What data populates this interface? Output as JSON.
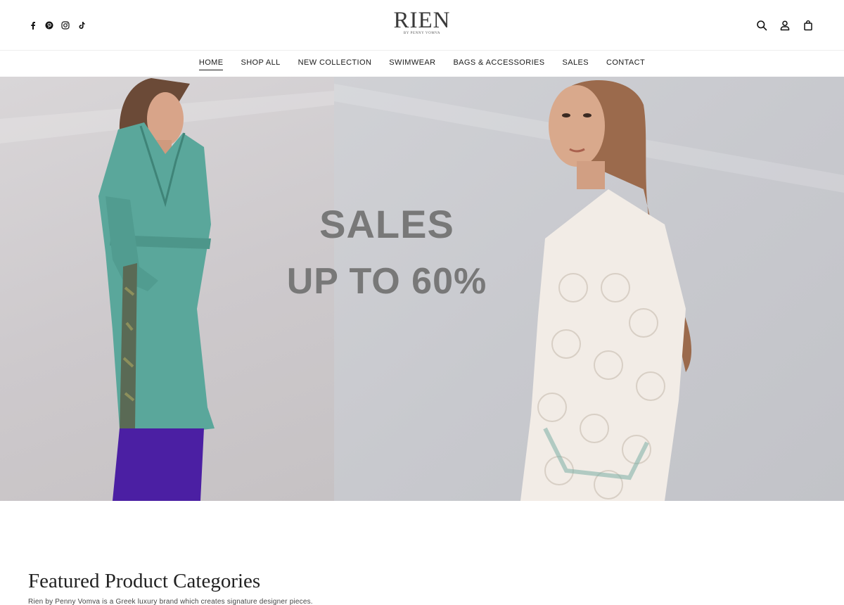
{
  "header": {
    "logo_text": "RIEN",
    "logo_subtext": "BY PENNY VOMVA",
    "social_icons": [
      "facebook-icon",
      "pinterest-icon",
      "instagram-icon",
      "tiktok-icon"
    ],
    "tool_icons": [
      "search-icon",
      "account-icon",
      "bag-icon"
    ]
  },
  "nav": {
    "items": [
      {
        "label": "HOME",
        "active": true
      },
      {
        "label": "SHOP ALL"
      },
      {
        "label": "NEW COLLECTION"
      },
      {
        "label": "SWIMWEAR"
      },
      {
        "label": "BAGS & ACCESSORIES"
      },
      {
        "label": "SALES"
      },
      {
        "label": "CONTACT"
      }
    ]
  },
  "hero": {
    "line1": "SALES",
    "line2": "UP TO 60%"
  },
  "featured": {
    "title": "Featured Product Categories",
    "description": "Rien by Penny Vomva is a Greek luxury brand which creates signature designer pieces."
  },
  "colors": {
    "text": "#1a1a1a",
    "hero_text": "#787878",
    "coat_teal": "#5aa79b",
    "pants_purple": "#4b1fa3"
  }
}
